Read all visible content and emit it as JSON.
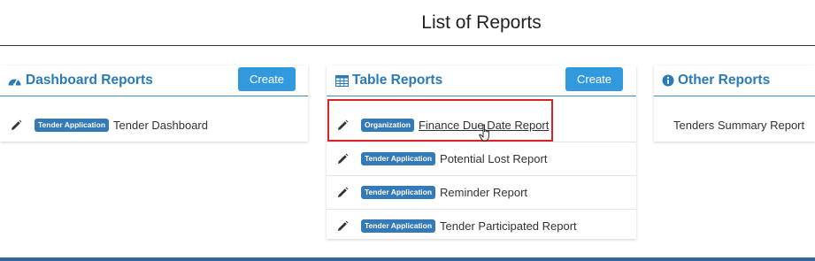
{
  "page": {
    "title": "List of Reports"
  },
  "panels": {
    "dashboard": {
      "title": "Dashboard Reports",
      "icon": "dashboard-icon",
      "create_label": "Create",
      "items": [
        {
          "badge": "Tender Application",
          "name": "Tender Dashboard"
        }
      ]
    },
    "table": {
      "title": "Table Reports",
      "icon": "table-icon",
      "create_label": "Create",
      "items": [
        {
          "badge": "Organization",
          "name": "Finance Due Date Report"
        },
        {
          "badge": "Tender Application",
          "name": "Potential Lost Report"
        },
        {
          "badge": "Tender Application",
          "name": "Reminder Report"
        },
        {
          "badge": "Tender Application",
          "name": "Tender Participated Report"
        }
      ]
    },
    "other": {
      "title": "Other Reports",
      "icon": "info-icon",
      "items": [
        {
          "name": "Tenders Summary Report"
        }
      ]
    }
  },
  "colors": {
    "accent": "#3399dd",
    "heading": "#2a7ab8",
    "badge": "#337ab7",
    "highlight": "#d9252a"
  }
}
